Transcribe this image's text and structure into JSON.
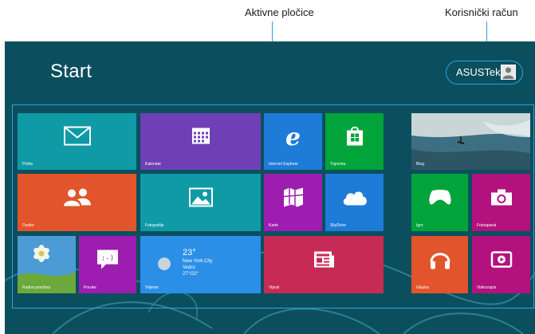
{
  "callouts": {
    "live_tiles": "Aktivne pločice",
    "user_account": "Korisnički račun"
  },
  "screen": {
    "title": "Start",
    "user_name": "ASUSTek"
  },
  "tiles": {
    "mail": {
      "label": "Pošta",
      "color": "#0f9aa5",
      "icon": "mail-icon"
    },
    "calendar": {
      "label": "Kalendar",
      "color": "#6f40b5",
      "icon": "calendar-icon"
    },
    "internet_explorer": {
      "label": "Internet Explorer",
      "color": "#1e7bd8",
      "icon": "internet-explorer-icon"
    },
    "store": {
      "label": "Trgovina",
      "color": "#00a43b",
      "icon": "store-icon"
    },
    "bing": {
      "label": "Bing",
      "icon": "surfer-photo"
    },
    "people": {
      "label": "Osobe",
      "color": "#e2542b",
      "icon": "people-icon"
    },
    "photos": {
      "label": "Fotografije",
      "color": "#0f9aa5",
      "icon": "photos-icon"
    },
    "maps": {
      "label": "Karte",
      "color": "#9d1db0",
      "icon": "maps-icon"
    },
    "skydrive": {
      "label": "SkyDrive",
      "color": "#1e7bd8",
      "icon": "cloud-icon"
    },
    "games": {
      "label": "Igre",
      "color": "#00a43b",
      "icon": "controller-icon"
    },
    "camera": {
      "label": "Fotoaparat",
      "color": "#b3117e",
      "icon": "camera-icon"
    },
    "desktop": {
      "label": "Radna površina",
      "icon": "flower-photo"
    },
    "messaging": {
      "label": "Poruke",
      "color": "#9d1db0",
      "icon": "chat-smiley-icon"
    },
    "weather": {
      "label": "Vrijeme",
      "color": "#2b8fe8",
      "icon": "weather-icon",
      "temperature": "23°",
      "city": "New York City",
      "condition": "Vedro",
      "range": "27°/22°"
    },
    "news": {
      "label": "Vijesti",
      "color": "#c72a55",
      "icon": "news-icon"
    },
    "music": {
      "label": "Glazba",
      "color": "#e2542b",
      "icon": "headphones-icon"
    },
    "video": {
      "label": "Videozapis",
      "color": "#b3117e",
      "icon": "video-icon"
    }
  },
  "colors": {
    "background": "#0b4f5f",
    "callout_line": "#2aa2d8"
  }
}
